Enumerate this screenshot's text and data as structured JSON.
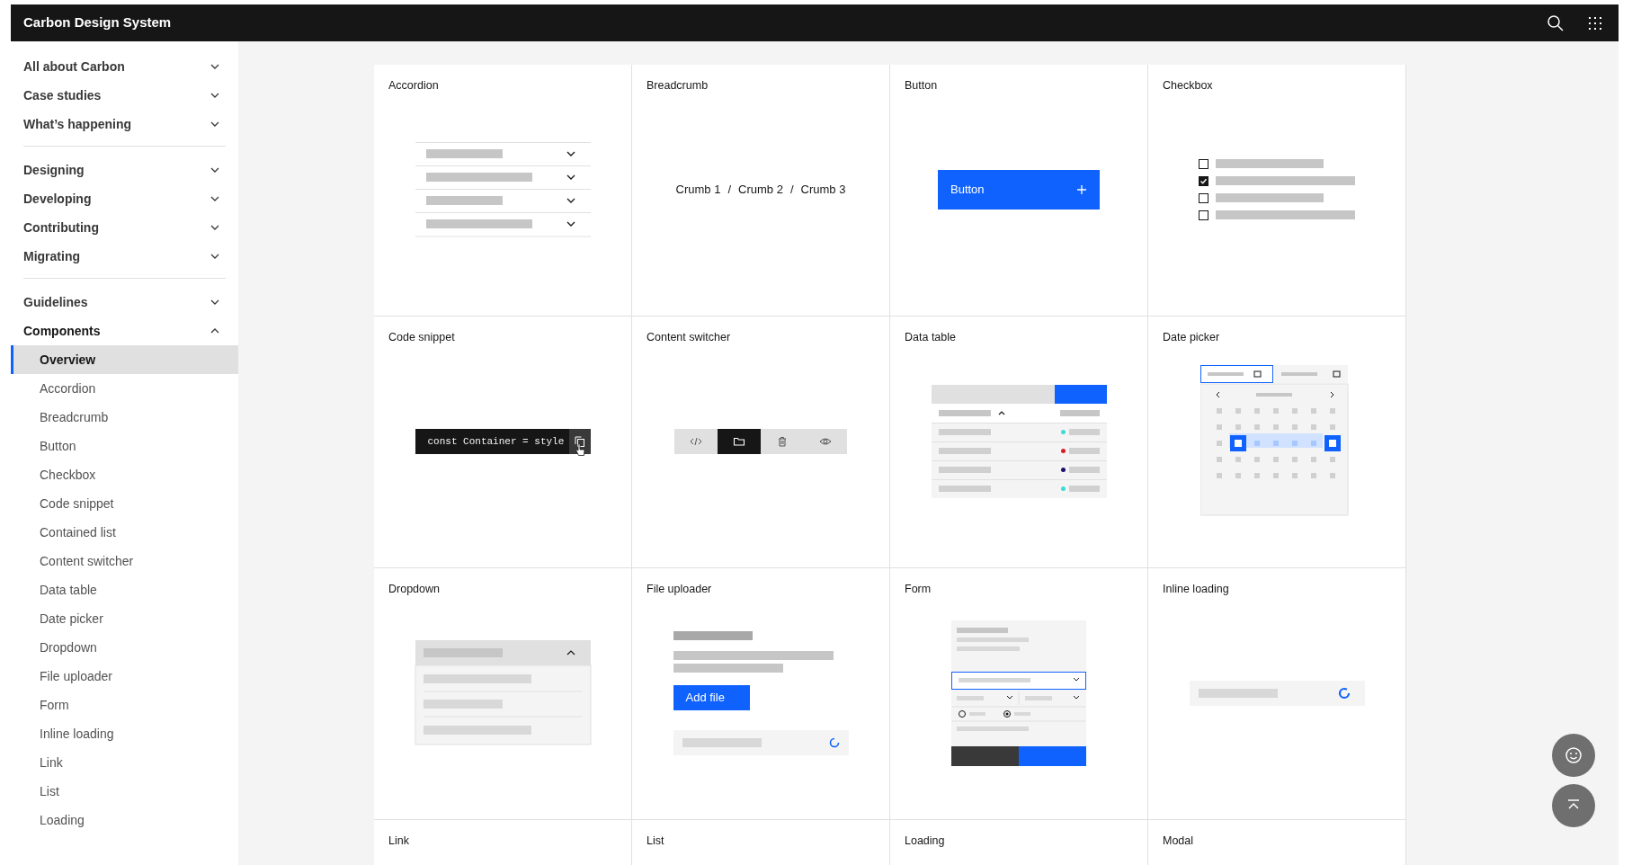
{
  "header": {
    "title": "Carbon Design System"
  },
  "sidebar": {
    "groups": [
      [
        {
          "label": "All about Carbon",
          "expanded": false
        },
        {
          "label": "Case studies",
          "expanded": false
        },
        {
          "label": "What’s happening",
          "expanded": false
        }
      ],
      [
        {
          "label": "Designing",
          "expanded": false
        },
        {
          "label": "Developing",
          "expanded": false
        },
        {
          "label": "Contributing",
          "expanded": false
        },
        {
          "label": "Migrating",
          "expanded": false
        }
      ],
      [
        {
          "label": "Guidelines",
          "expanded": false
        },
        {
          "label": "Components",
          "expanded": true,
          "children": [
            {
              "label": "Overview",
              "selected": true
            },
            {
              "label": "Accordion",
              "selected": false
            },
            {
              "label": "Breadcrumb",
              "selected": false
            },
            {
              "label": "Button",
              "selected": false
            },
            {
              "label": "Checkbox",
              "selected": false
            },
            {
              "label": "Code snippet",
              "selected": false
            },
            {
              "label": "Contained list",
              "selected": false
            },
            {
              "label": "Content switcher",
              "selected": false
            },
            {
              "label": "Data table",
              "selected": false
            },
            {
              "label": "Date picker",
              "selected": false
            },
            {
              "label": "Dropdown",
              "selected": false
            },
            {
              "label": "File uploader",
              "selected": false
            },
            {
              "label": "Form",
              "selected": false
            },
            {
              "label": "Inline loading",
              "selected": false
            },
            {
              "label": "Link",
              "selected": false
            },
            {
              "label": "List",
              "selected": false
            },
            {
              "label": "Loading",
              "selected": false
            }
          ]
        }
      ]
    ]
  },
  "cards": [
    {
      "title": "Accordion",
      "kind": "accordion"
    },
    {
      "title": "Breadcrumb",
      "kind": "breadcrumb",
      "crumbs": [
        "Crumb 1",
        "Crumb 2",
        "Crumb 3"
      ],
      "separators": [
        "/",
        "/"
      ]
    },
    {
      "title": "Button",
      "kind": "button",
      "label": "Button"
    },
    {
      "title": "Checkbox",
      "kind": "checkbox",
      "boxes": [
        {
          "checked": false
        },
        {
          "checked": true
        },
        {
          "checked": false
        },
        {
          "checked": false
        }
      ]
    },
    {
      "title": "Code snippet",
      "kind": "code_snippet",
      "code": "const Container = style"
    },
    {
      "title": "Content switcher",
      "kind": "content_switcher",
      "segments": [
        {
          "selected": false
        },
        {
          "selected": true
        },
        {
          "selected": false
        },
        {
          "selected": false
        }
      ]
    },
    {
      "title": "Data table",
      "kind": "data_table",
      "rows": [
        {
          "color": "#3ddbd9"
        },
        {
          "color": "#da1e28"
        },
        {
          "color": "#1c0f6e"
        },
        {
          "color": "#3ddbd9"
        }
      ]
    },
    {
      "title": "Date picker",
      "kind": "date_picker"
    },
    {
      "title": "Dropdown",
      "kind": "dropdown"
    },
    {
      "title": "File uploader",
      "kind": "file_uploader",
      "button": "Add file"
    },
    {
      "title": "Form",
      "kind": "form"
    },
    {
      "title": "Inline loading",
      "kind": "inline_loading"
    },
    {
      "title": "Link",
      "kind": "none"
    },
    {
      "title": "List",
      "kind": "none"
    },
    {
      "title": "Loading",
      "kind": "none"
    },
    {
      "title": "Modal",
      "kind": "none"
    }
  ]
}
